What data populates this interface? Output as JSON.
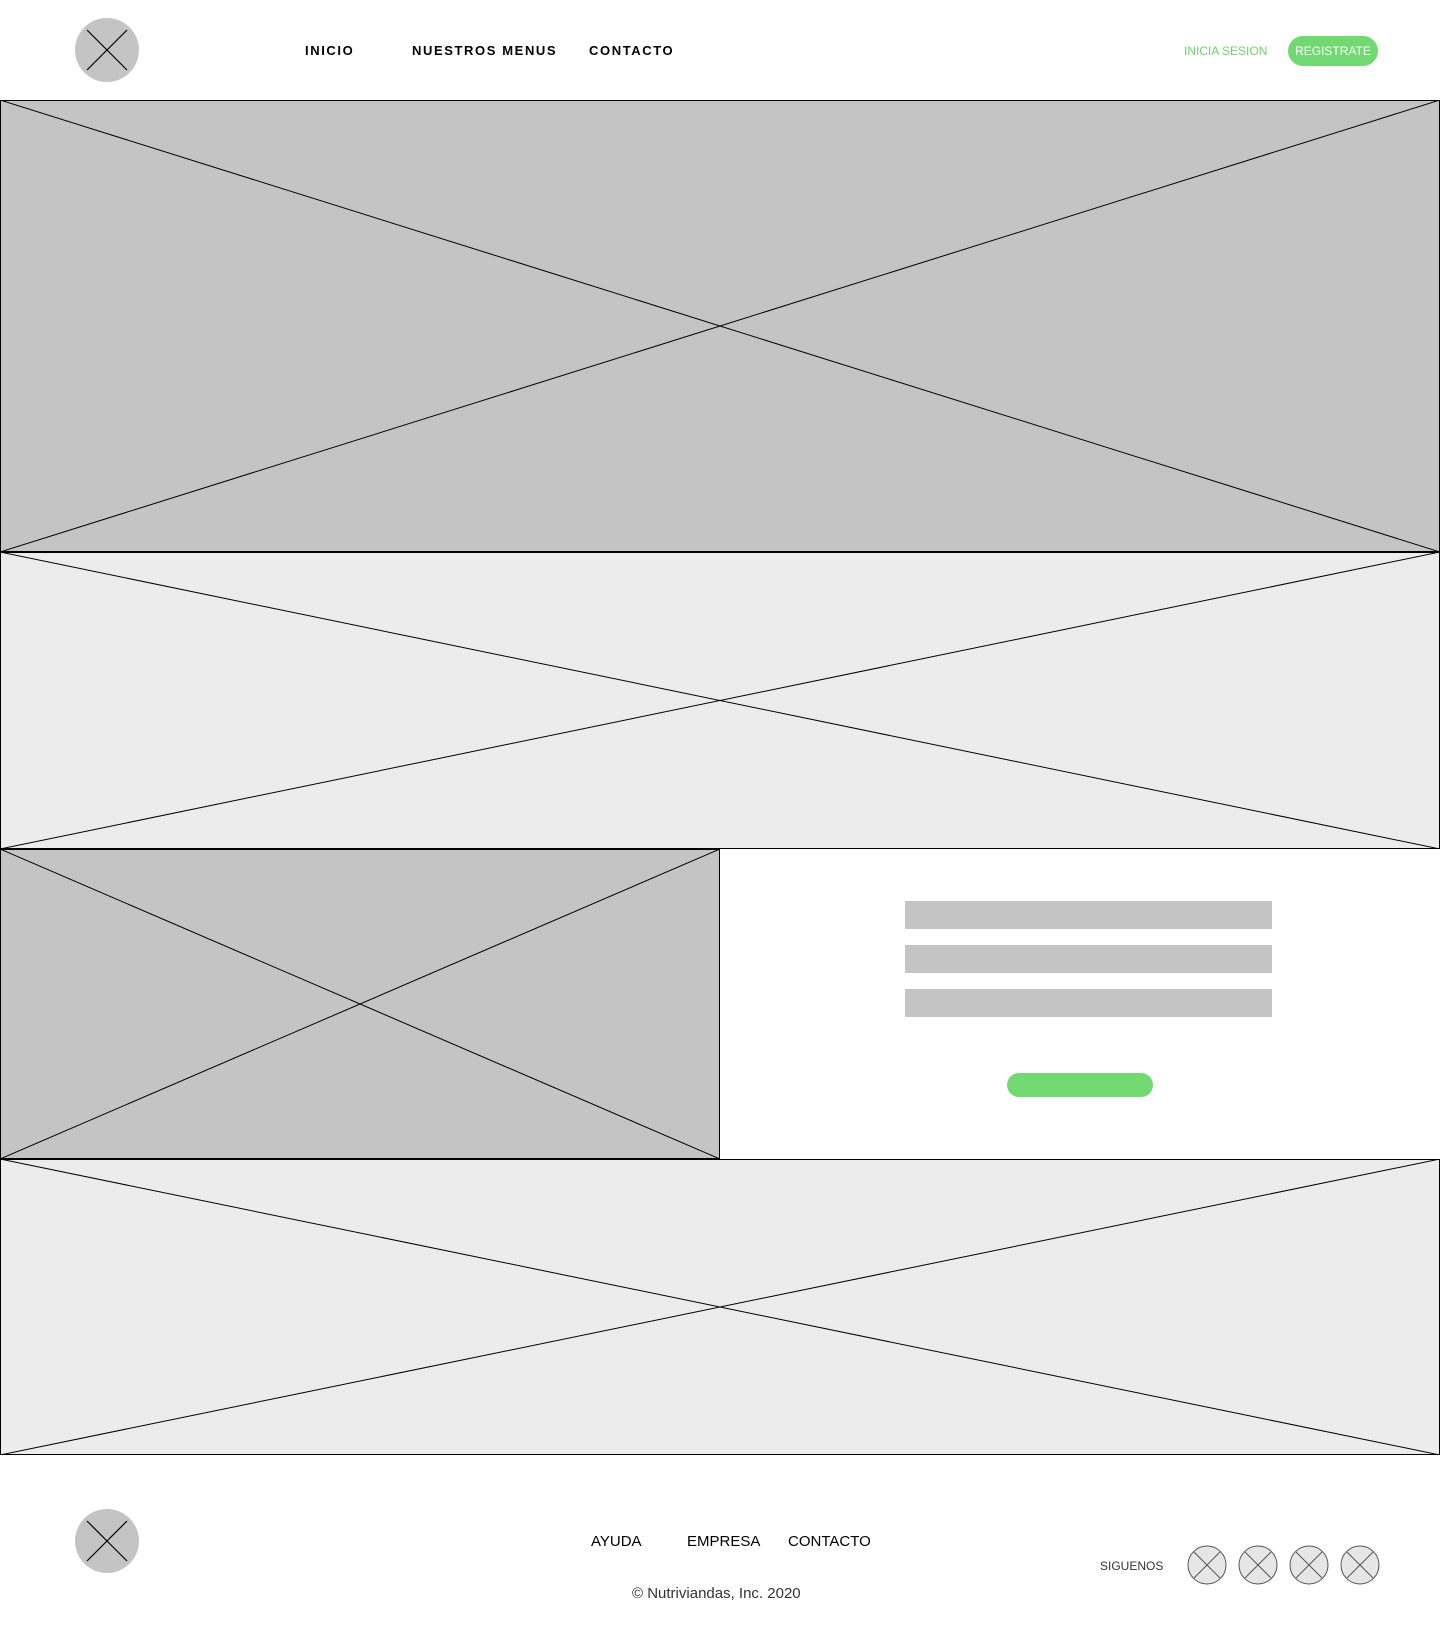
{
  "header": {
    "logo_icon": "logo-placeholder-icon",
    "nav": [
      {
        "label": "INICIO"
      },
      {
        "label": "NUESTROS MENUS"
      },
      {
        "label": "CONTACTO"
      }
    ],
    "login_label": "INICIA SESION",
    "register_label": "REGISTRATE"
  },
  "colors": {
    "accent_green": "#72d872",
    "placeholder_dark": "#c4c4c4",
    "placeholder_light": "#ececec"
  },
  "sections": {
    "hero_image": "image-placeholder",
    "banner_image": "image-placeholder",
    "side_image": "image-placeholder",
    "bottom_banner_image": "image-placeholder"
  },
  "form": {
    "fields": [
      "",
      "",
      ""
    ],
    "submit_label": ""
  },
  "footer": {
    "logo_icon": "logo-placeholder-icon",
    "links": [
      {
        "label": "AYUDA"
      },
      {
        "label": "EMPRESA"
      },
      {
        "label": "CONTACTO"
      }
    ],
    "copyright": "© Nutriviandas, Inc. 2020",
    "follow_label": "SIGUENOS",
    "social_icons": [
      "social-icon-1",
      "social-icon-2",
      "social-icon-3",
      "social-icon-4"
    ]
  }
}
